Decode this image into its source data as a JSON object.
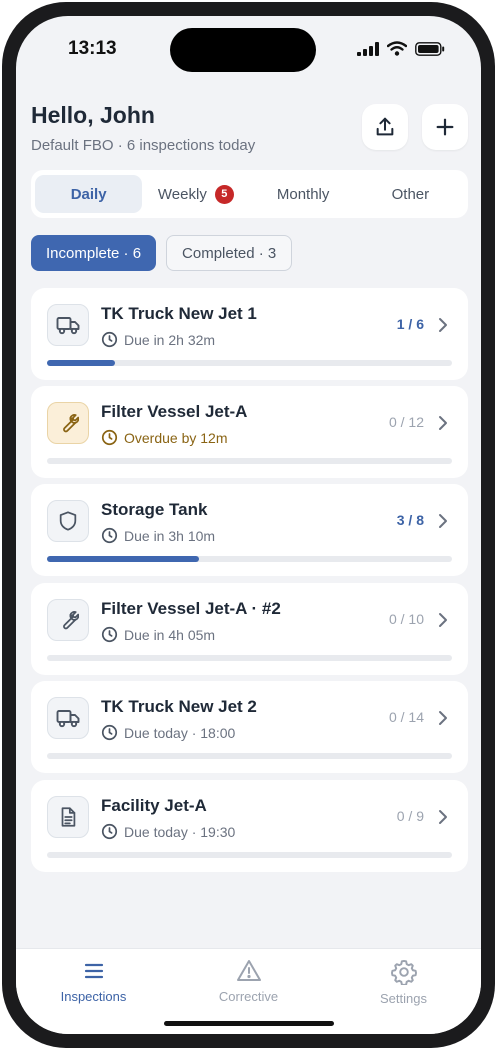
{
  "status": {
    "time": "13:13"
  },
  "header": {
    "greeting": "Hello, John",
    "subtitle": "Default FBO · 6 inspections today"
  },
  "tabs": [
    {
      "label": "Daily",
      "active": true
    },
    {
      "label": "Weekly",
      "badge": "5"
    },
    {
      "label": "Monthly"
    },
    {
      "label": "Other"
    }
  ],
  "filters": {
    "incomplete": "Incomplete · 6",
    "completed": "Completed · 3"
  },
  "inspections": [
    {
      "title": "TK Truck New Jet 1",
      "due": "Due in 2h 32m",
      "count": "1 / 6",
      "progress": 0.1667,
      "icon": "truck-icon"
    },
    {
      "title": "Filter Vessel Jet-A",
      "due": "Overdue by 12m",
      "count": "0 / 12",
      "progress": 0,
      "icon": "wrench-icon",
      "overdue": true
    },
    {
      "title": "Storage Tank",
      "due": "Due in 3h 10m",
      "count": "3 / 8",
      "progress": 0.375,
      "icon": "shield-icon"
    },
    {
      "title": "Filter Vessel Jet-A · #2",
      "due": "Due in 4h 05m",
      "count": "0 / 10",
      "progress": 0,
      "icon": "wrench-icon"
    },
    {
      "title": "TK Truck New Jet 2",
      "due": "Due today · 18:00",
      "count": "0 / 14",
      "progress": 0,
      "icon": "truck-icon"
    },
    {
      "title": "Facility Jet-A",
      "due": "Due today · 19:30",
      "count": "0 / 9",
      "progress": 0,
      "icon": "document-icon"
    }
  ],
  "tabbar": {
    "inspections": "Inspections",
    "corrective": "Corrective",
    "settings": "Settings"
  },
  "colors": {
    "accent": "#3f67b0",
    "overdue": "#8a6414",
    "badge": "#c62828"
  }
}
